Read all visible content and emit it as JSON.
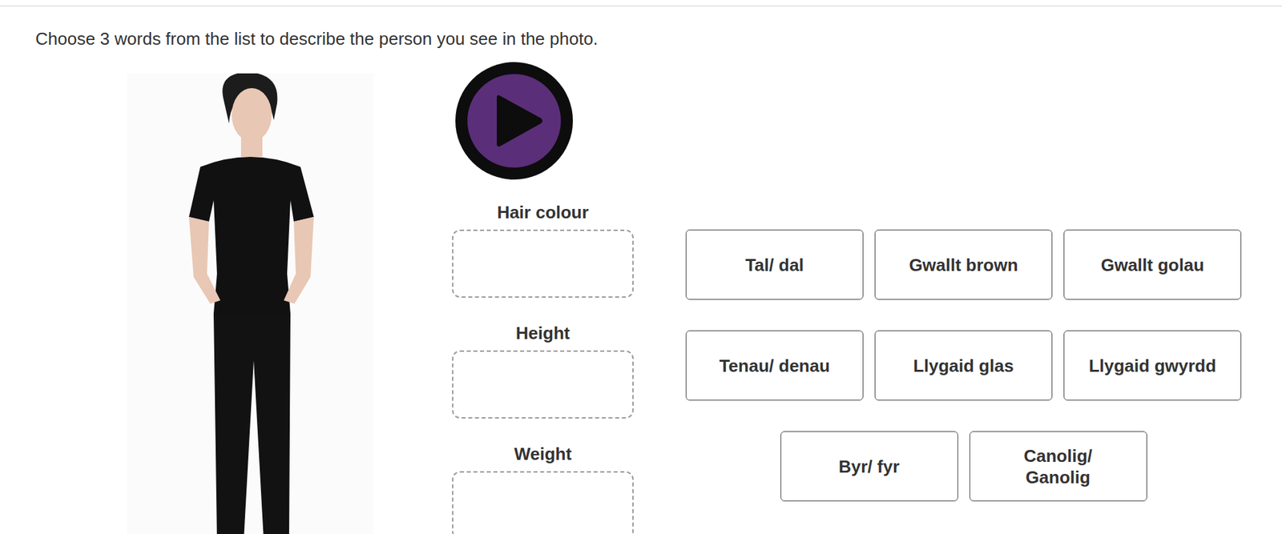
{
  "instruction": "Choose 3 words from the list to describe the person you see in the photo.",
  "drop_zones": [
    {
      "label": "Hair colour"
    },
    {
      "label": "Height"
    },
    {
      "label": "Weight"
    }
  ],
  "options": [
    {
      "label": "Tal/ dal"
    },
    {
      "label": "Gwallt brown"
    },
    {
      "label": "Gwallt golau"
    },
    {
      "label": "Tenau/ denau"
    },
    {
      "label": "Llygaid glas"
    },
    {
      "label": "Llygaid gwyrdd"
    },
    {
      "label": "Byr/ fyr"
    },
    {
      "label": "Canolig/\nGanolig"
    }
  ]
}
